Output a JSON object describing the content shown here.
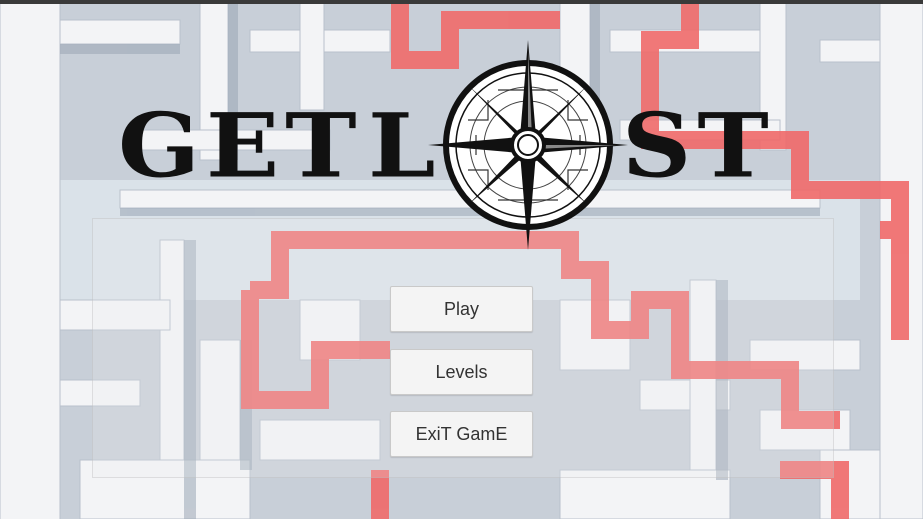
{
  "game": {
    "title_part1": "GET",
    "title_part2": "L",
    "title_part3": "ST"
  },
  "menu": {
    "play_label": "Play",
    "levels_label": "Levels",
    "exit_label": "ExiT GamE"
  },
  "colors": {
    "path_red": "#f06a6a",
    "wall_white": "#f2f3f5",
    "wall_shadow": "#a9b4c2",
    "title_black": "#111111"
  },
  "icons": [
    "compass-rose-icon"
  ]
}
